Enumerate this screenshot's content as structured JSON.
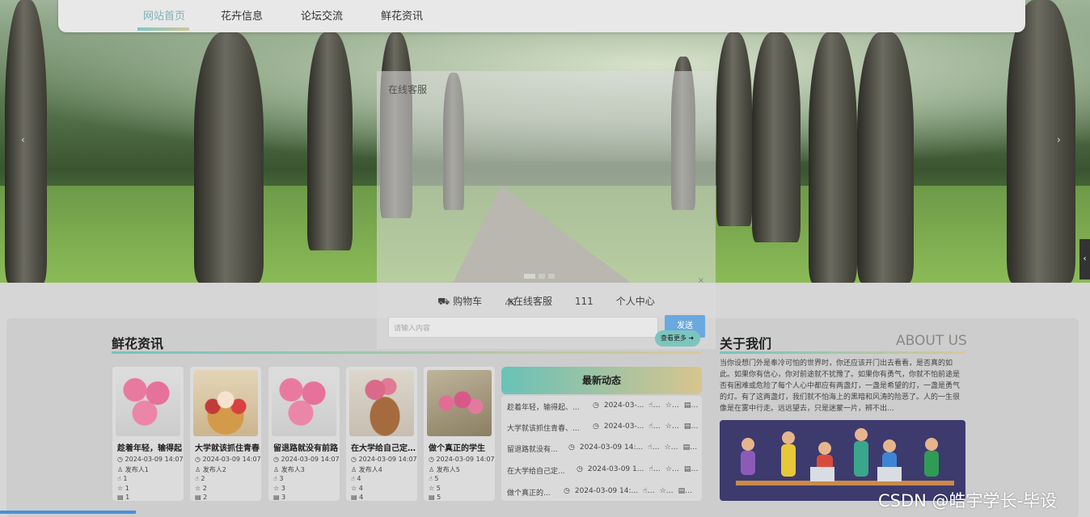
{
  "nav": {
    "items": [
      {
        "label": "网站首页",
        "active": true
      },
      {
        "label": "花卉信息",
        "active": false
      },
      {
        "label": "论坛交流",
        "active": false
      },
      {
        "label": "鲜花资讯",
        "active": false
      }
    ]
  },
  "carousel": {
    "prev": "‹",
    "next": "›",
    "side_tab": "‹"
  },
  "modal": {
    "title": "在线客服",
    "close": "×",
    "toolbar": [
      "购物车",
      "在线客服",
      "111",
      "个人中心"
    ],
    "input_placeholder": "请输入内容",
    "send_label": "发送"
  },
  "news_section": {
    "title": "鲜花资讯",
    "more_label": "查看更多",
    "cards": [
      {
        "title": "趁着年轻，输得起",
        "date": "2024-03-09 14:07",
        "author": "发布人1",
        "likes": "1",
        "favs": "1",
        "views": "1"
      },
      {
        "title": "大学就该抓住青春",
        "date": "2024-03-09 14:07",
        "author": "发布人2",
        "likes": "2",
        "favs": "2",
        "views": "2"
      },
      {
        "title": "留退路就没有前路",
        "date": "2024-03-09 14:07",
        "author": "发布人3",
        "likes": "3",
        "favs": "3",
        "views": "3"
      },
      {
        "title": "在大学给自己定个目标",
        "date": "2024-03-09 14:07",
        "author": "发布人4",
        "likes": "4",
        "favs": "4",
        "views": "4"
      },
      {
        "title": "做个真正的学生",
        "date": "2024-03-09 14:07",
        "author": "发布人5",
        "likes": "5",
        "favs": "5",
        "views": "5"
      }
    ]
  },
  "latest": {
    "title": "最新动态",
    "rows": [
      {
        "title": "趁着年轻，输得起、...",
        "date": "2024-03-..."
      },
      {
        "title": "大学就该抓住青春、...",
        "date": "2024-03-..."
      },
      {
        "title": "留退路就没有...",
        "date": "2024-03-09 14:..."
      },
      {
        "title": "在大学给自己定...",
        "date": "2024-03-09 1..."
      },
      {
        "title": "做个真正的...",
        "date": "2024-03-09 14:..."
      }
    ]
  },
  "about": {
    "title": "关于我们",
    "subtitle": "ABOUT US",
    "text": "当你设想门外是奉冷可怕的世界时，你还应该开门出去看看，是否真的如此。如果你有信心，你对前途就不犹豫了。如果你有勇气，你就不怕前途是否有困难或危险了每个人心中都应有两盏灯，一盏是希望的灯，一盏是勇气的灯。有了这两盏灯，我们就不怕海上的黑暗和风涛的险恶了。人的一生很像是在雾中行走。远远望去，只是迷蒙一片，辨不出..."
  },
  "watermark": "CSDN @皓宇学长-毕设",
  "colors": {
    "accent_teal": "#74c4bd",
    "accent_gold": "#d7c99a",
    "send_blue": "#6aa8e0"
  }
}
